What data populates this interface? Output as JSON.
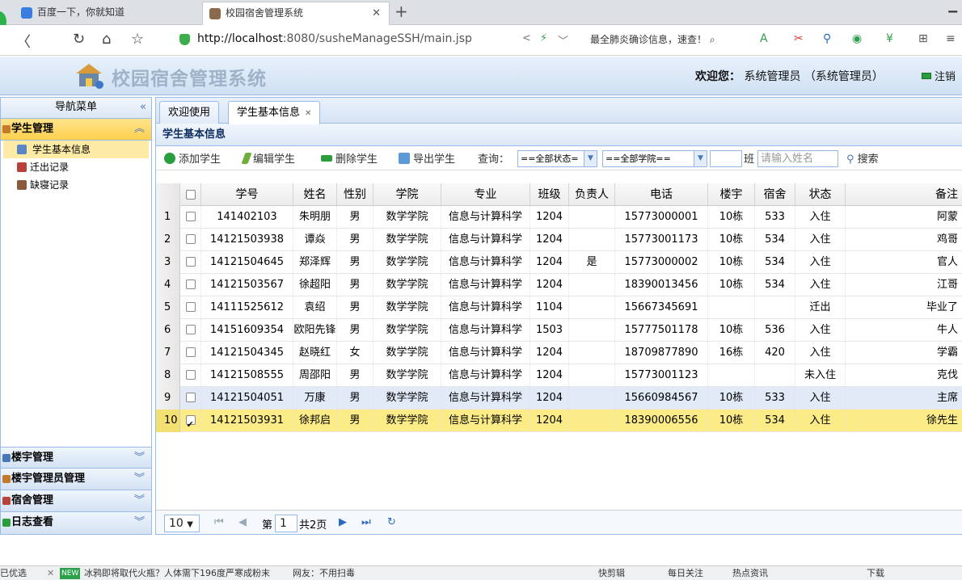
{
  "browser": {
    "tabs": [
      {
        "label": "百度一下，你就知道"
      },
      {
        "label": "校园宿舍管理系统"
      }
    ],
    "new_tab": "+",
    "url_host": "http://localhost",
    "url_rest": ":8080/susheManageSSH/main.jsp",
    "news": "最全肺炎确诊信息，速查！"
  },
  "header": {
    "app_title": "校园宿舍管理系统",
    "welcome_label": "欢迎您：",
    "user": "系统管理员 （系统管理员）",
    "logout": "注销"
  },
  "sidebar": {
    "title": "导航菜单",
    "active_group": "学生管理",
    "items": [
      {
        "label": "学生基本信息"
      },
      {
        "label": "迁出记录"
      },
      {
        "label": "缺寝记录"
      }
    ],
    "groups": [
      {
        "label": "楼宇管理"
      },
      {
        "label": "楼宇管理员管理"
      },
      {
        "label": "宿舍管理"
      },
      {
        "label": "日志查看"
      }
    ]
  },
  "main": {
    "tabs": [
      {
        "label": "欢迎使用"
      },
      {
        "label": "学生基本信息"
      }
    ],
    "panel_title": "学生基本信息",
    "toolbar": {
      "add": "添加学生",
      "edit": "编辑学生",
      "delete": "删除学生",
      "export": "导出学生",
      "query_label": "查询：",
      "status_select": "==全部状态=",
      "college_select": "==全部学院==",
      "class_label": "班",
      "name_placeholder": "请输入姓名",
      "search": "搜索"
    },
    "columns": [
      "学号",
      "姓名",
      "性别",
      "学院",
      "专业",
      "班级",
      "负责人",
      "电话",
      "楼宇",
      "宿舍",
      "状态",
      "备注"
    ],
    "rows": [
      {
        "n": "1",
        "id": "141402103",
        "name": "朱明朋",
        "sex": "男",
        "college": "数学学院",
        "major": "信息与计算科学",
        "cls": "1204",
        "lead": "",
        "phone": "15773000001",
        "bld": "10栋",
        "room": "533",
        "status": "入住",
        "note": "阿蒙"
      },
      {
        "n": "2",
        "id": "14121503938",
        "name": "谭焱",
        "sex": "男",
        "college": "数学学院",
        "major": "信息与计算科学",
        "cls": "1204",
        "lead": "",
        "phone": "15773001173",
        "bld": "10栋",
        "room": "534",
        "status": "入住",
        "note": "鸡哥"
      },
      {
        "n": "3",
        "id": "14121504645",
        "name": "郑泽辉",
        "sex": "男",
        "college": "数学学院",
        "major": "信息与计算科学",
        "cls": "1204",
        "lead": "是",
        "phone": "15773000002",
        "bld": "10栋",
        "room": "534",
        "status": "入住",
        "note": "官人"
      },
      {
        "n": "4",
        "id": "14121503567",
        "name": "徐超阳",
        "sex": "男",
        "college": "数学学院",
        "major": "信息与计算科学",
        "cls": "1204",
        "lead": "",
        "phone": "18390013456",
        "bld": "10栋",
        "room": "534",
        "status": "入住",
        "note": "江哥"
      },
      {
        "n": "5",
        "id": "14111525612",
        "name": "袁绍",
        "sex": "男",
        "college": "数学学院",
        "major": "信息与计算科学",
        "cls": "1104",
        "lead": "",
        "phone": "15667345691",
        "bld": "",
        "room": "",
        "status": "迁出",
        "note": "毕业了"
      },
      {
        "n": "6",
        "id": "14151609354",
        "name": "欧阳先锋",
        "sex": "男",
        "college": "数学学院",
        "major": "信息与计算科学",
        "cls": "1503",
        "lead": "",
        "phone": "15777501178",
        "bld": "10栋",
        "room": "536",
        "status": "入住",
        "note": "牛人"
      },
      {
        "n": "7",
        "id": "14121504345",
        "name": "赵晓红",
        "sex": "女",
        "college": "数学学院",
        "major": "信息与计算科学",
        "cls": "1204",
        "lead": "",
        "phone": "18709877890",
        "bld": "16栋",
        "room": "420",
        "status": "入住",
        "note": "学霸"
      },
      {
        "n": "8",
        "id": "14121508555",
        "name": "周邵阳",
        "sex": "男",
        "college": "数学学院",
        "major": "信息与计算科学",
        "cls": "1204",
        "lead": "",
        "phone": "15773001123",
        "bld": "",
        "room": "",
        "status": "未入住",
        "note": "克伐"
      },
      {
        "n": "9",
        "id": "14121504051",
        "name": "万康",
        "sex": "男",
        "college": "数学学院",
        "major": "信息与计算科学",
        "cls": "1204",
        "lead": "",
        "phone": "15660984567",
        "bld": "10栋",
        "room": "533",
        "status": "入住",
        "note": "主席"
      },
      {
        "n": "10",
        "id": "14121503931",
        "name": "徐邦启",
        "sex": "男",
        "college": "数学学院",
        "major": "信息与计算科学",
        "cls": "1204",
        "lead": "",
        "phone": "18390006556",
        "bld": "10栋",
        "room": "534",
        "status": "入住",
        "note": "徐先生"
      }
    ],
    "selected_row": "10",
    "hover_row": "9",
    "pager": {
      "page_size": "10",
      "page_label": "第",
      "page_value": "1",
      "total": "共2页"
    }
  },
  "statusbar": {
    "left": "已优选",
    "news": "冰鸦即将取代火瓶？人体需下196度严寒成粉末",
    "news2": "网友：不用扫毒",
    "right": [
      "快剪辑",
      "每日关注",
      "热点资讯",
      "下载"
    ]
  },
  "colors": {
    "accent_blue": "#99bbe8",
    "selected_row": "#fbec88",
    "active_group": "#ffd04d"
  }
}
